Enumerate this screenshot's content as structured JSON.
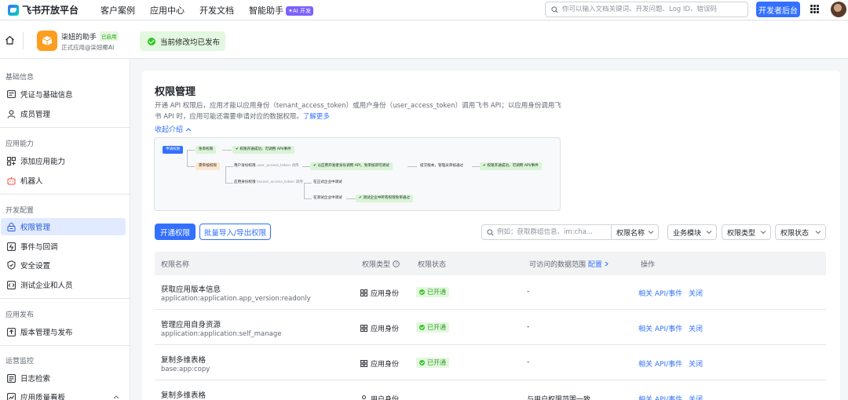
{
  "topnav": {
    "brand": "飞书开放平台",
    "links": [
      "客户案例",
      "应用中心",
      "开发文档",
      "智能助手"
    ],
    "ai_badge": "✦AI 开发",
    "search_placeholder": "你可以输入文档关键词、开发问题、Log ID、错误码",
    "dev_button": "开发者后台"
  },
  "app": {
    "name": "柒妞的助手",
    "tag": "已启用",
    "owner": "正式应用@柒妞椰AI",
    "toast": "当前修改均已发布"
  },
  "sidebar": {
    "groups": [
      "基础信息",
      "应用能力",
      "开发配置",
      "应用发布",
      "运营监控"
    ],
    "items": [
      {
        "label": "凭证与基础信息",
        "icon": "credential-icon"
      },
      {
        "label": "成员管理",
        "icon": "member-icon"
      },
      {
        "label": "添加应用能力",
        "icon": "add-ability-icon"
      },
      {
        "label": "机器人",
        "icon": "robot-icon"
      },
      {
        "label": "权限管理",
        "icon": "permission-icon"
      },
      {
        "label": "事件与回调",
        "icon": "event-icon"
      },
      {
        "label": "安全设置",
        "icon": "shield-icon"
      },
      {
        "label": "测试企业和人员",
        "icon": "test-icon"
      },
      {
        "label": "版本管理与发布",
        "icon": "version-icon"
      },
      {
        "label": "日志检索",
        "icon": "log-icon"
      },
      {
        "label": "应用质量看板",
        "icon": "dashboard-icon"
      }
    ],
    "active": "权限管理"
  },
  "main": {
    "title": "权限管理",
    "desc_1": "开通 API 权限后，应用才能以应用身份（tenant_access_token）或用户身份（user_access_token）调用飞书 API；以应用身份调用飞书 API 时，应用可能还需要申请对应的数据权限。",
    "learn_more": "了解更多",
    "collapse": "收起介绍",
    "flow": {
      "apply": "申请权限",
      "no_review": "免审权限",
      "opened_1": "权限开通成功，可调用 API/事件",
      "need_review": "需审核权限",
      "user_perm": "用户身份权限",
      "user_token": "user_access_token 调用",
      "app_test": "以应用开发者身份调用 API，免审核即可调试",
      "submit": "提交版本，管理员审核通过",
      "opened_2": "权限开通成功，可调用 API/事件",
      "app_perm": "应用身份权限",
      "tenant_token": "tenant_access_token 调用",
      "prod_tenant": "在正式企业中调试",
      "test_tenant": "在测试企业中调试",
      "test_auto": "测试企业中所有权限免审通过"
    },
    "btn_open": "开通权限",
    "btn_batch": "批量导入/导出权限",
    "filter": {
      "search_placeholder": "例如：获取群组信息、im:cha...",
      "name_select": "权限名称",
      "module": "业务模块",
      "type": "权限类型",
      "status": "权限状态"
    },
    "table": {
      "headers": [
        "权限名称",
        "权限类型",
        "权限状态",
        "可访问的数据范围",
        "配置",
        "操作"
      ],
      "rows": [
        {
          "name": "获取应用版本信息",
          "code": "application:application.app_version:readonly",
          "type": "应用身份",
          "status": "已开通",
          "scope": "-",
          "action": "相关 API/事件",
          "close": "关闭"
        },
        {
          "name": "管理应用自身资源",
          "code": "application:application:self_manage",
          "type": "应用身份",
          "status": "已开通",
          "scope": "-",
          "action": "相关 API/事件",
          "close": "关闭"
        },
        {
          "name": "复制多维表格",
          "code": "base:app:copy",
          "type": "应用身份",
          "status": "已开通",
          "scope": "-",
          "action": "相关 API/事件",
          "close": "关闭"
        },
        {
          "name": "复制多维表格",
          "code": "",
          "type": "用户身份",
          "status": "",
          "scope": "与用户权限范围一致",
          "action": "相关 API/事件",
          "close": "关闭"
        }
      ]
    }
  },
  "colors": {
    "accent": "#3370ff",
    "success": "#34c724",
    "active_bg": "#e1eaff",
    "app_icon": "#ff9d1f"
  }
}
